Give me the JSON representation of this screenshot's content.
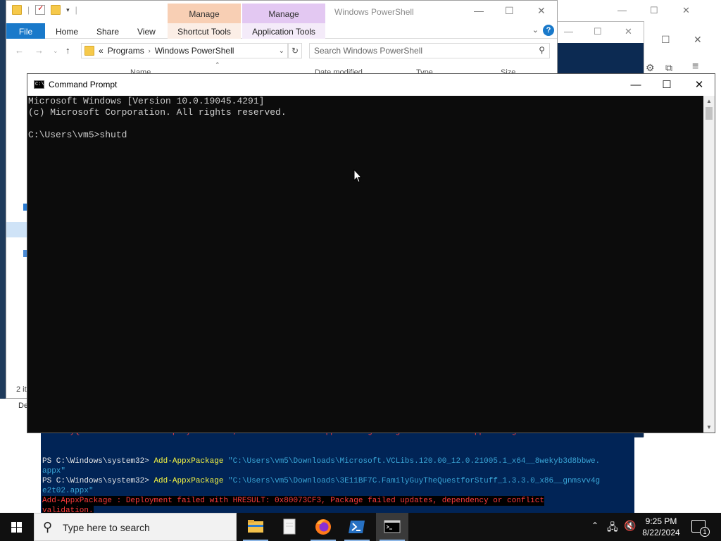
{
  "background_window": {
    "controls": [
      "—",
      "☐",
      "✕"
    ]
  },
  "explorer": {
    "title": "Windows PowerShell",
    "context_tabs": [
      "Manage",
      "Manage"
    ],
    "ribbon_tabs": [
      "File",
      "Home",
      "Share",
      "View",
      "Shortcut Tools",
      "Application Tools"
    ],
    "address": {
      "prefix": "«",
      "segments": [
        "Programs",
        "Windows PowerShell"
      ]
    },
    "search_placeholder": "Search Windows PowerShell",
    "columns": [
      "Name",
      "Date modified",
      "Type",
      "Size"
    ],
    "status_text": "2 it"
  },
  "powershell": {
    "lines": [
      {
        "kind": "err",
        "text": "    + FullyQualifiedErrorId : DeploymentError,Microsoft.Windows.Appx.PackageManager.Commands.AddAppxPackageCommand"
      },
      {
        "kind": "blank",
        "text": ""
      },
      {
        "kind": "cmd",
        "prompt": "PS C:\\Windows\\system32> ",
        "cmd": "Add-AppxPackage ",
        "arg": "\"C:\\Users\\vm5\\Downloads\\Microsoft.VCLibs.120.00_12.0.21005.1_x64__8wekyb3d8bbwe."
      },
      {
        "kind": "cont",
        "text": "appx\""
      },
      {
        "kind": "cmd",
        "prompt": "PS C:\\Windows\\system32> ",
        "cmd": "Add-AppxPackage ",
        "arg": "\"C:\\Users\\vm5\\Downloads\\3E11BF7C.FamilyGuyTheQuestforStuff_1.3.3.0_x86__gnmsvv4g"
      },
      {
        "kind": "cont",
        "text": "e2t02.appx\""
      },
      {
        "kind": "errbg",
        "text": "Add-AppxPackage : Deployment failed with HRESULT: 0x80073CF3, Package failed updates, dependency or conflict"
      },
      {
        "kind": "errbg",
        "text": "validation."
      }
    ]
  },
  "cmd": {
    "title": "Command Prompt",
    "icon_text": "C:\\",
    "controls": {
      "minimize": "—",
      "maximize": "☐",
      "close": "✕"
    },
    "lines": [
      "Microsoft Windows [Version 10.0.19045.4291]",
      "(c) Microsoft Corporation. All rights reserved.",
      "",
      "C:\\Users\\vm5>shutd"
    ]
  },
  "taskbar": {
    "search_placeholder": "Type here to search",
    "apps": [
      "File Explorer",
      "Notepad",
      "Firefox",
      "Windows PowerShell",
      "Command Prompt"
    ],
    "clock": {
      "time": "9:25 PM",
      "date": "8/22/2024"
    },
    "notification_count": "1"
  }
}
